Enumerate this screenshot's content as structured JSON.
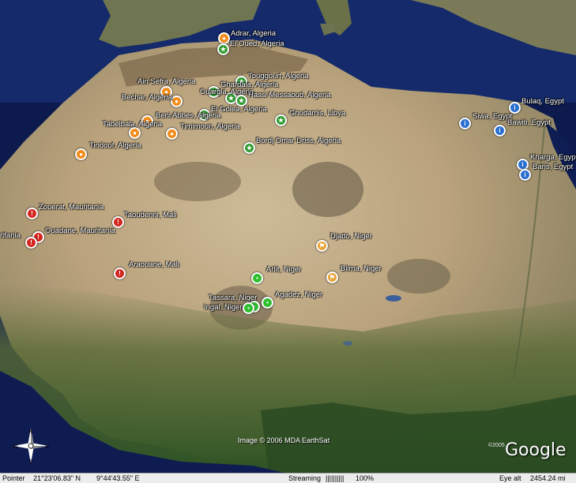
{
  "map": {
    "credit": "Image © 2006 MDA EarthSat",
    "copyright_year": "©2005",
    "logo": "Google",
    "compass": {
      "n": "N",
      "s": "S",
      "e": "E",
      "w": "W",
      "icon": "compass-rose-icon"
    }
  },
  "markers": [
    {
      "label": "Adrar, Algeria",
      "type": "orange",
      "icon": "person-icon"
    },
    {
      "label": "El Oued, Algeria",
      "type": "green",
      "icon": "star-icon"
    },
    {
      "label": "Touggourt, Algeria",
      "type": "green",
      "icon": "star-icon"
    },
    {
      "label": "Ain Sefra, Algeria",
      "type": "orange",
      "icon": "person-icon"
    },
    {
      "label": "Ghardaia, Algeria",
      "type": "green",
      "icon": "star-icon"
    },
    {
      "label": "Ouargla, Algeria",
      "type": "green",
      "icon": "star-icon"
    },
    {
      "label": "Hassi Messaoud, Algeria",
      "type": "green",
      "icon": "star-icon"
    },
    {
      "label": "Bechar, Algeria",
      "type": "orange",
      "icon": "person-icon"
    },
    {
      "label": "El Golea, Algeria",
      "type": "green",
      "icon": "star-icon"
    },
    {
      "label": "Ghudamis, Libya",
      "type": "green",
      "icon": "star-icon"
    },
    {
      "label": "Beni Abbes, Algeria",
      "type": "orange",
      "icon": "person-icon"
    },
    {
      "label": "Tabelbala, Algeria",
      "type": "orange",
      "icon": "person-icon"
    },
    {
      "label": "Timimoun, Algeria",
      "type": "orange",
      "icon": "person-icon"
    },
    {
      "label": "Bordj Omar Driss, Algeria",
      "type": "green",
      "icon": "star-icon"
    },
    {
      "label": "Tindouf, Algeria",
      "type": "orange",
      "icon": "person-icon"
    },
    {
      "label": "Zouerat, Mauritania",
      "type": "red",
      "icon": "warning-icon"
    },
    {
      "label": "Taoudenni, Mali",
      "type": "red",
      "icon": "warning-icon"
    },
    {
      "label": "Ouadane, Mauritania",
      "type": "red",
      "icon": "warning-icon"
    },
    {
      "label": "rifania",
      "type": "red",
      "icon": "warning-icon"
    },
    {
      "label": "Araouane, Mali",
      "type": "red",
      "icon": "warning-icon"
    },
    {
      "label": "Djado, Niger",
      "type": "flag",
      "icon": "flag-icon"
    },
    {
      "label": "Bilma, Niger",
      "type": "flag",
      "icon": "flag-icon"
    },
    {
      "label": "Arlit, Niger",
      "type": "ngreen",
      "icon": "dot-icon"
    },
    {
      "label": "Tassara, Niger",
      "type": "ngreen",
      "icon": "dot-icon"
    },
    {
      "label": "Agadez, Niger",
      "type": "ngreen",
      "icon": "dot-icon"
    },
    {
      "label": "Ingal, Niger",
      "type": "ngreen",
      "icon": "dot-icon"
    },
    {
      "label": "Siwa, Egypt",
      "type": "blue",
      "icon": "info-icon"
    },
    {
      "label": "Bulaq, Egypt",
      "type": "blue",
      "icon": "info-icon"
    },
    {
      "label": "Bawiti, Egypt",
      "type": "blue",
      "icon": "info-icon"
    },
    {
      "label": "Kharga, Egypt",
      "type": "blue",
      "icon": "info-icon"
    },
    {
      "label": "Baris, Egypt",
      "type": "blue",
      "icon": "info-icon"
    }
  ],
  "status": {
    "pointer_label": "Pointer",
    "lat": "21°23'06.83\" N",
    "lon": "9°44'43.55\" E",
    "streaming_label": "Streaming",
    "streaming_bar": "||||||||||",
    "streaming_pct": "100%",
    "eye_alt_label": "Eye alt",
    "eye_alt_value": "2454.24 mi"
  }
}
